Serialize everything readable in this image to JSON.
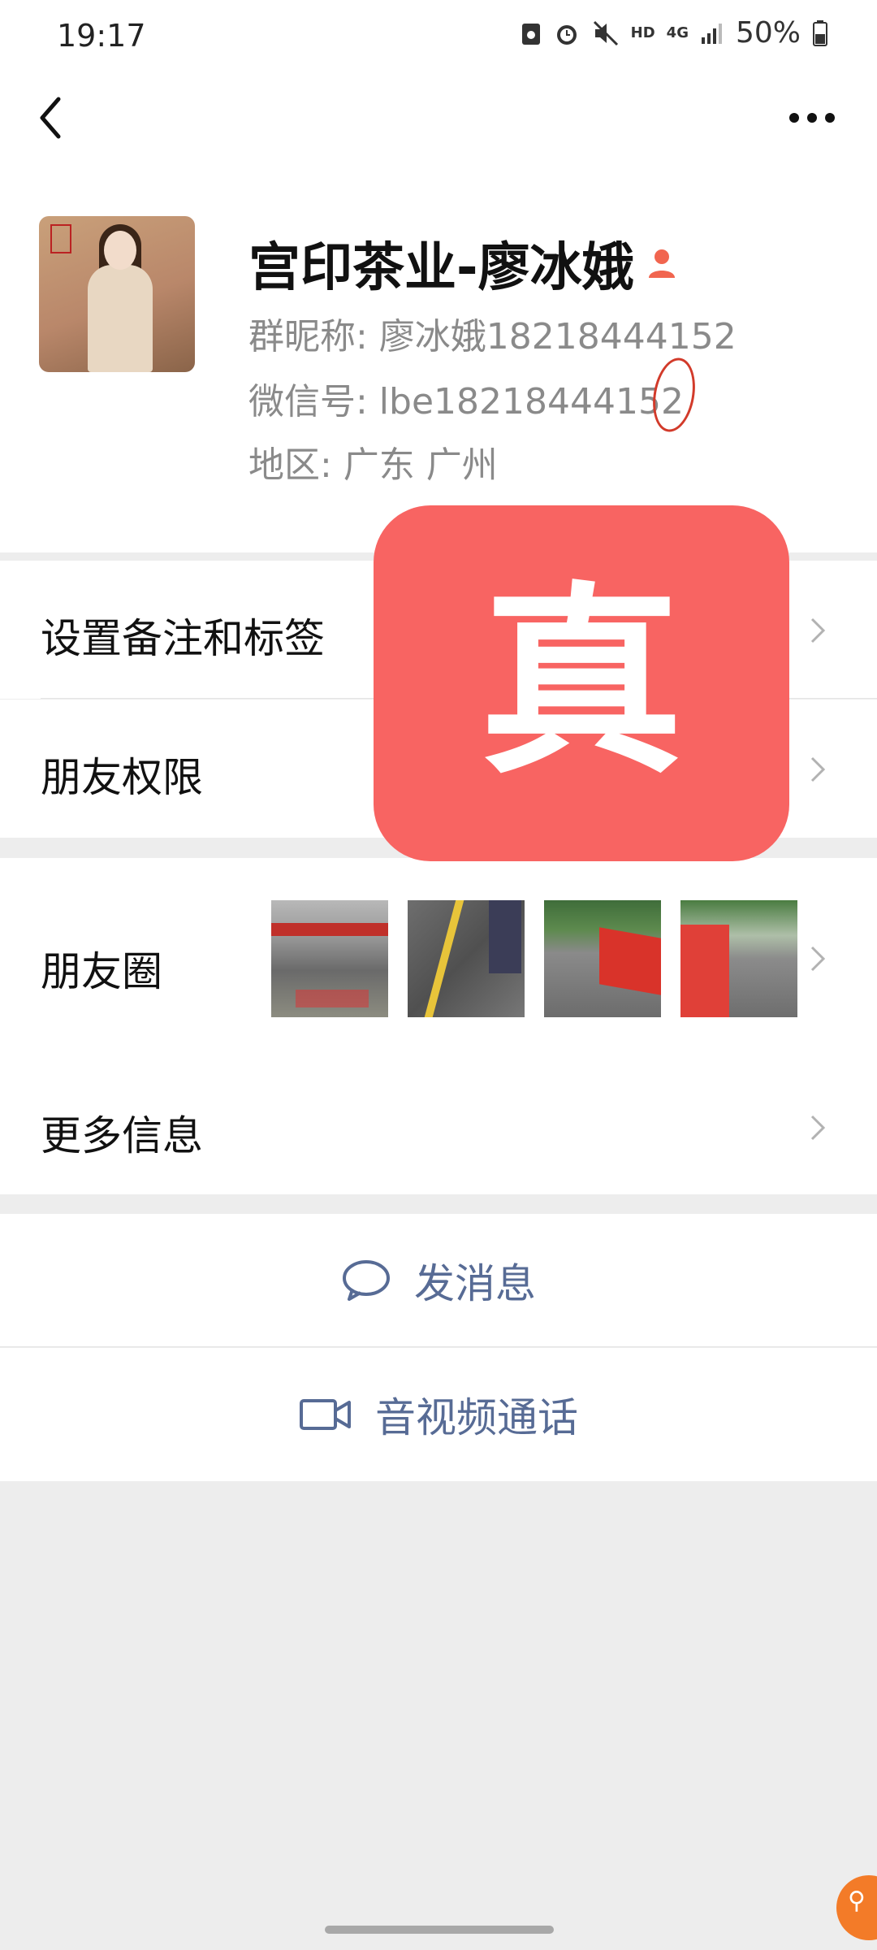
{
  "status_bar": {
    "time": "19:17",
    "battery": "50%",
    "icons": [
      "screenshot-icon",
      "alarm-icon",
      "mute-icon",
      "hd-icon",
      "4g-icon",
      "signal-icon",
      "battery-icon"
    ],
    "hd": "HD",
    "net": "4G"
  },
  "nav": {
    "back_icon": "chevron-left-icon",
    "more_icon": "ellipsis-icon"
  },
  "profile": {
    "name": "宫印茶业-廖冰娥",
    "group_nickname": "群昵称:  廖冰娥18218444152",
    "wechat_id": "微信号:  lbe18218444152",
    "region": "地区:  广东  广州"
  },
  "rows": {
    "remark": "设置备注和标签",
    "permissions": "朋友权限",
    "moments": "朋友圈",
    "more_info": "更多信息"
  },
  "actions": {
    "message": "发消息",
    "call": "音视频通话"
  },
  "overlay": {
    "stamp_text": "真",
    "color": "#f86462"
  },
  "colors": {
    "accent": "#576b95",
    "background": "#ededed"
  }
}
